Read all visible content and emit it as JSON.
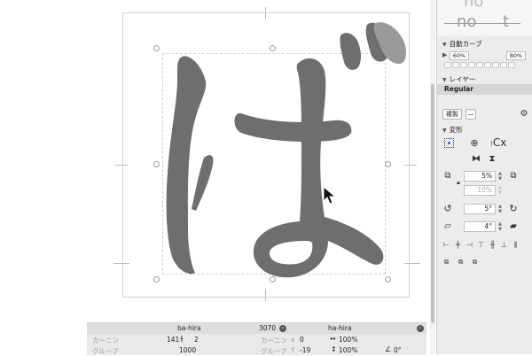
{
  "canvas": {
    "glyph_char": "ぱ",
    "glyph_color": "#6e6e6e",
    "accent_preview": "#9a9a9a"
  },
  "sidebar": {
    "preview_text_top": "no",
    "preview_text_mid": "no",
    "preview_text_right": "t",
    "smart_curve_label": "自動カーブ",
    "curve_left": "60%",
    "curve_right": "80%",
    "layer_label": "レイヤー",
    "layer_name": "Regular",
    "duplicate_label": "複製",
    "dash_label": "—",
    "transform_label": "変形",
    "cx_label": "Cx",
    "scale_value": "5%",
    "scale_value2": "10%",
    "rotate_value": "5°",
    "slant_value": "4°"
  },
  "bottom": {
    "left_glyph": "ba-hira",
    "unicode": "3070",
    "right_glyph": "ha-hira",
    "kerning_label": "カーニン",
    "kerning_left_value": "141",
    "kerning_right_value": "2",
    "group_label": "グループ",
    "group_value": "1000",
    "kerning_label_right": "カーニン",
    "x_label": "x",
    "x_value": "0",
    "width_pct": "100%",
    "group_label_right": "グループ",
    "y_label": "Y",
    "y_value": "-19",
    "height_pct": "100%",
    "angle_value": "0°"
  }
}
